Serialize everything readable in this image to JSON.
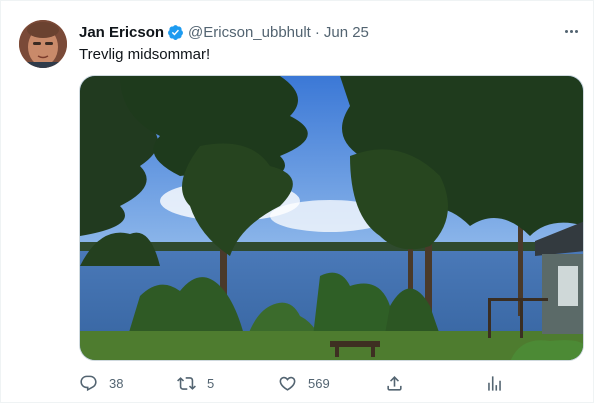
{
  "tweet": {
    "author_name": "Jan Ericson",
    "handle": "@Ericson_ubbhult",
    "separator": "·",
    "date": "Jun 25",
    "text": "Trevlig midsommar!",
    "verified": true
  },
  "actions": {
    "replies": "38",
    "retweets": "5",
    "likes": "569"
  },
  "icons": {
    "verified": "verified-badge-icon",
    "more": "more-horizontal-icon",
    "reply": "reply-icon",
    "retweet": "retweet-icon",
    "like": "heart-icon",
    "share": "share-icon",
    "analytics": "analytics-icon"
  },
  "colors": {
    "verified_blue": "#1d9bf0",
    "secondary_text": "#536471",
    "primary_text": "#0f1419"
  }
}
